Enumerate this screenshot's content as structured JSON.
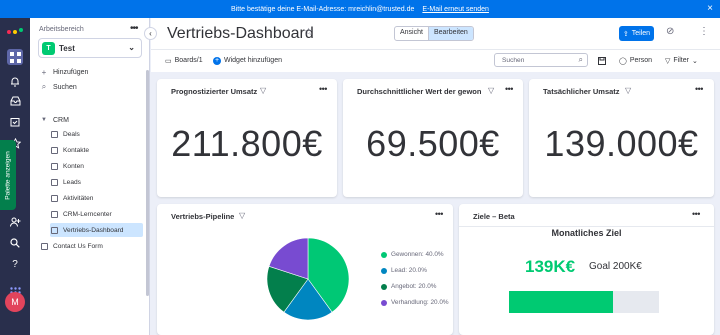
{
  "banner": {
    "message": "Bitte bestätige deine E-Mail-Adresse: mreichlin@trusted.de",
    "link": "E-Mail erneut senden",
    "close_icon": "×"
  },
  "rail": {
    "feedback_label": "Palette anzeigen",
    "avatar_initial": "M"
  },
  "sidebar": {
    "workspace_label": "Arbeitsbereich",
    "workspace_name": "Test",
    "workspace_badge": "T",
    "add_label": "Hinzufügen",
    "search_label": "Suchen",
    "folder_label": "CRM",
    "items": [
      {
        "label": "Deals"
      },
      {
        "label": "Kontakte"
      },
      {
        "label": "Konten"
      },
      {
        "label": "Leads"
      },
      {
        "label": "Aktivitäten"
      },
      {
        "label": "CRM-Lerncenter"
      },
      {
        "label": "Vertriebs-Dashboard"
      }
    ],
    "extra_item": "Contact Us Form"
  },
  "header": {
    "title": "Vertriebs-Dashboard",
    "view_label": "Ansicht",
    "edit_label": "Bearbeiten",
    "share_label": "Teilen"
  },
  "toolbar": {
    "boards_label": "Boards/1",
    "add_widget_label": "Widget hinzufügen",
    "search_placeholder": "Suchen",
    "person_label": "Person",
    "filter_label": "Filter"
  },
  "widgets": {
    "forecast": {
      "title": "Prognostizierter Umsatz",
      "value": "211.800€"
    },
    "avg_deal": {
      "title": "Durchschnittlicher Wert der gewon...",
      "value": "69.500€"
    },
    "actual": {
      "title": "Tatsächlicher Umsatz",
      "value": "139.000€"
    },
    "pipeline": {
      "title": "Vertriebs-Pipeline"
    },
    "goal": {
      "title": "Ziele – Beta",
      "heading": "Monatliches Ziel",
      "current": "139K€",
      "target": "Goal 200K€",
      "progress": 0.695,
      "bar_color": "#00ca72"
    }
  },
  "chart_data": {
    "type": "pie",
    "categories": [
      "Gewonnen",
      "Lead",
      "Angebot",
      "Verhandlung"
    ],
    "values": [
      40.0,
      20.0,
      20.0,
      20.0
    ],
    "legend_labels": [
      "Gewonnen: 40.0%",
      "Lead: 20.0%",
      "Angebot: 20.0%",
      "Verhandlung: 20.0%"
    ],
    "colors": [
      "#00c875",
      "#0086c0",
      "#037f4c",
      "#784bd1"
    ],
    "legend": "right"
  }
}
